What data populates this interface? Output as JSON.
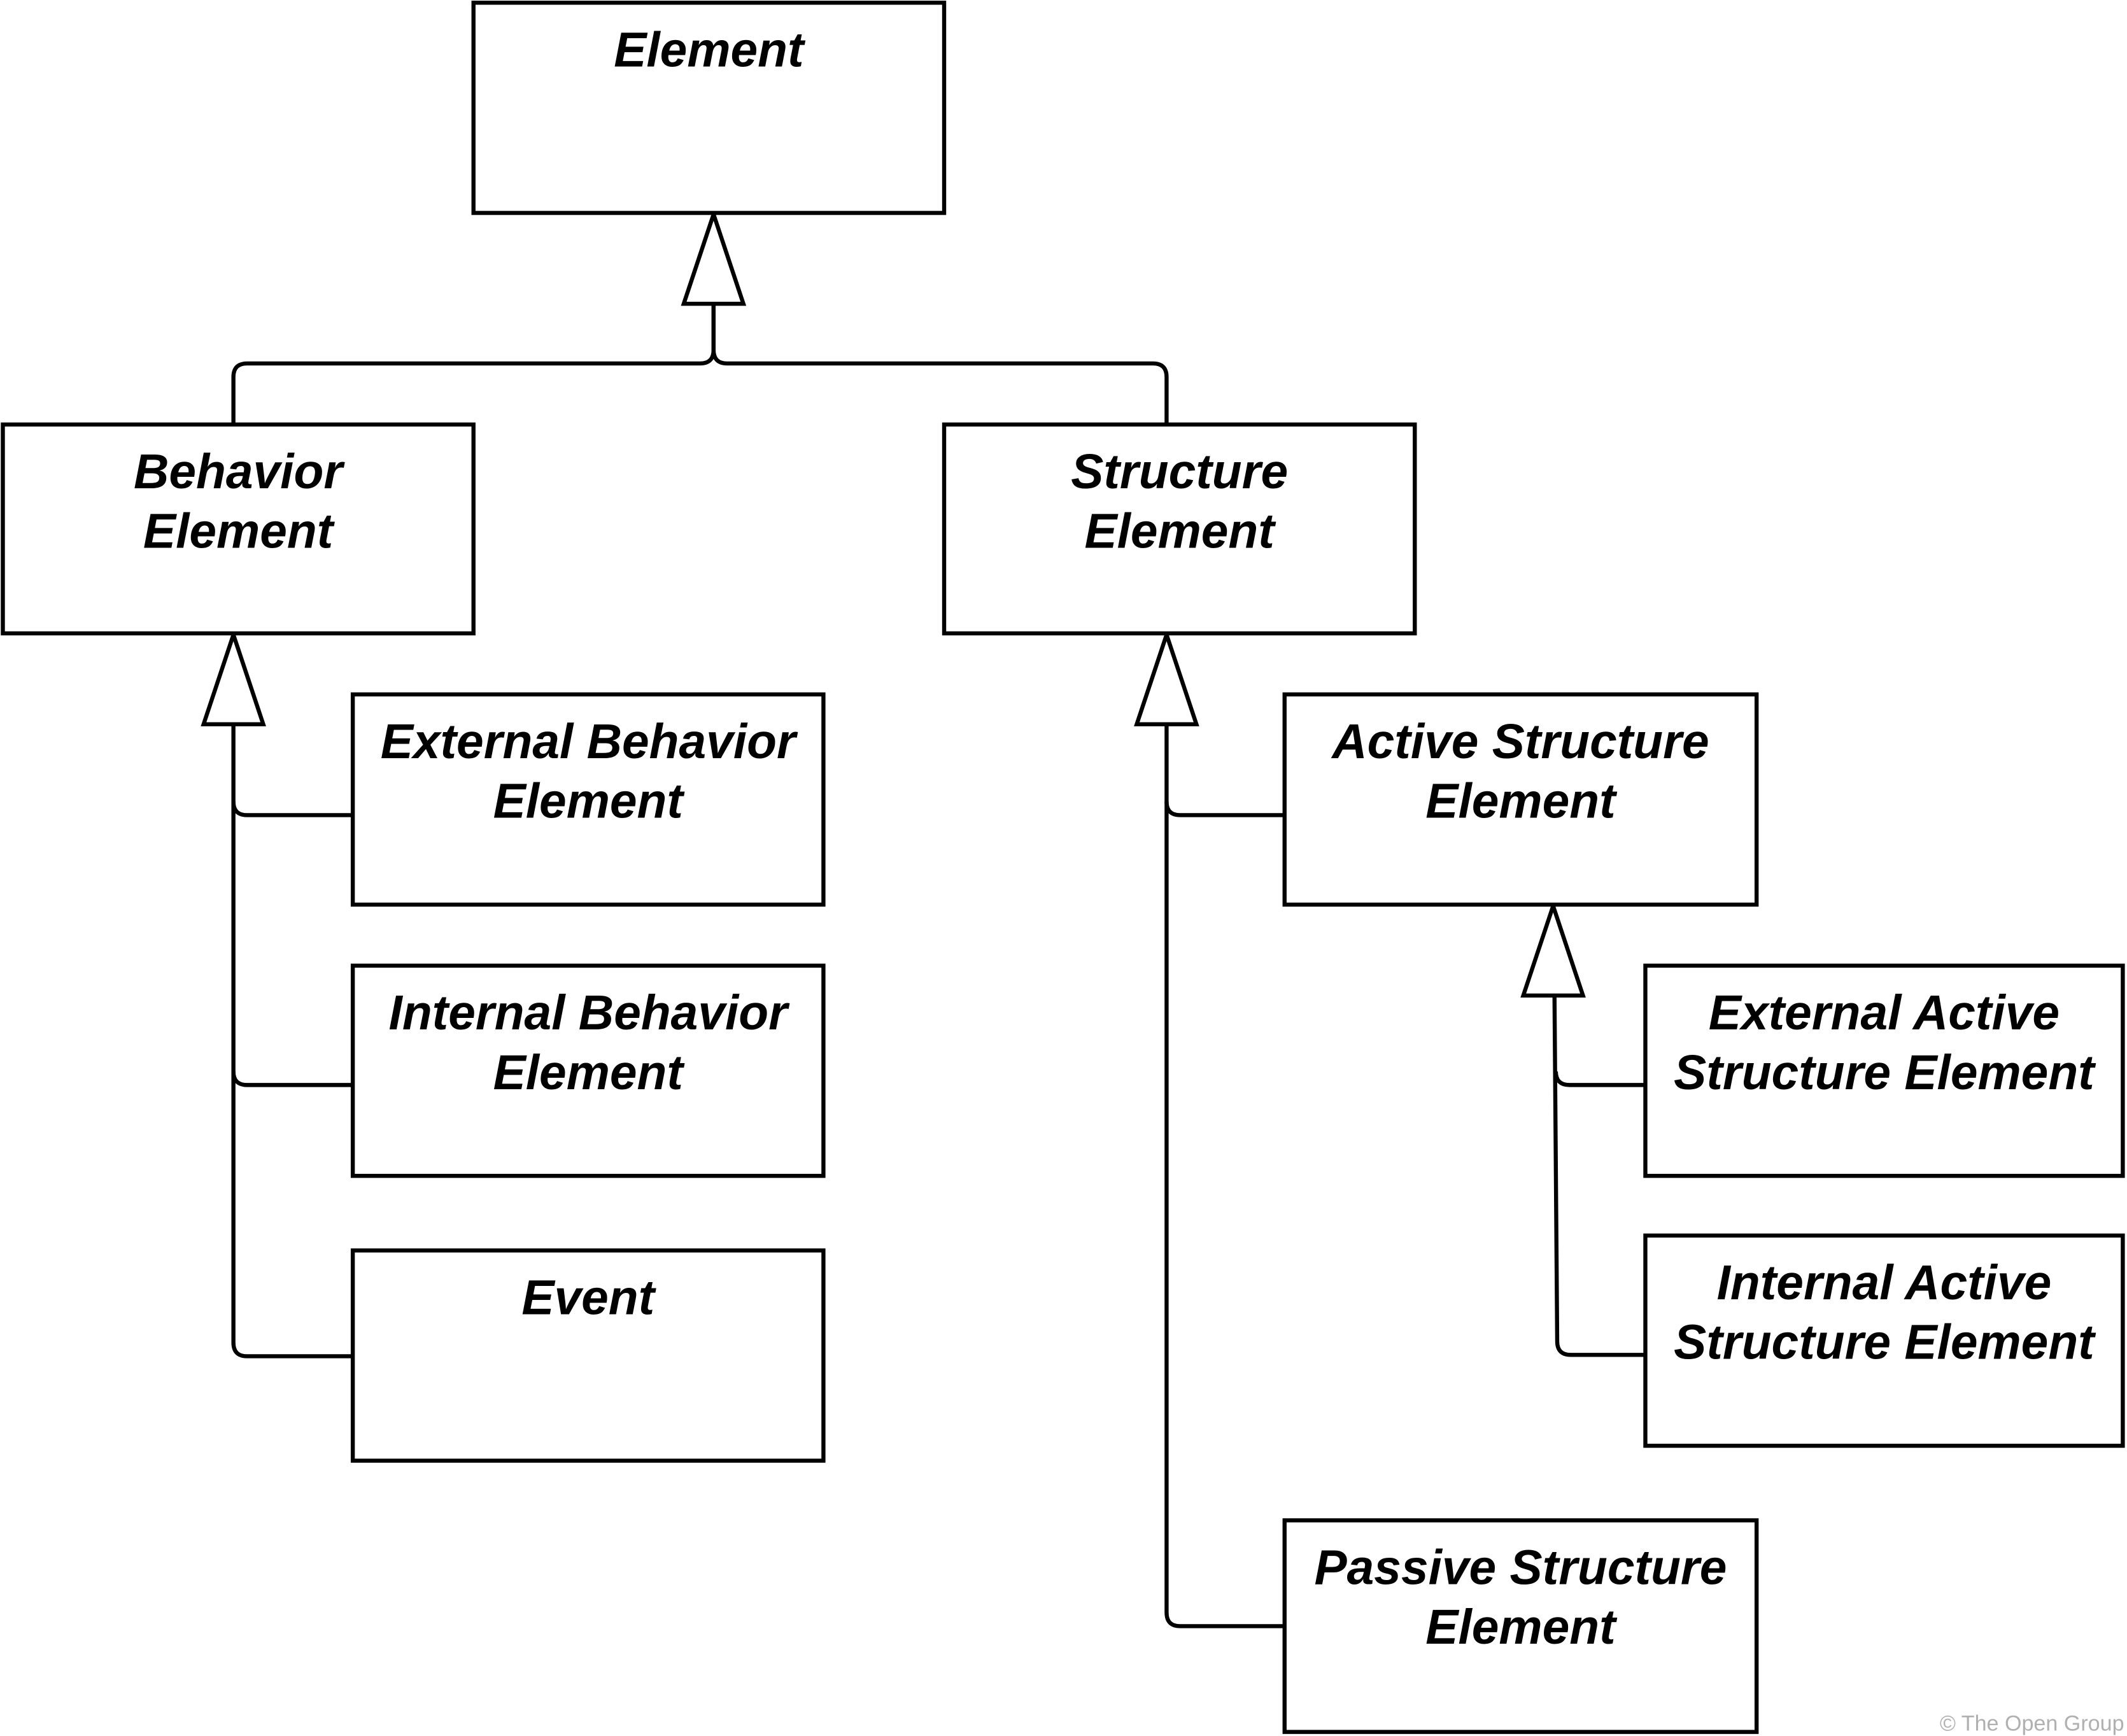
{
  "elements": [
    {
      "id": "element",
      "lines": [
        "Element"
      ]
    },
    {
      "id": "behavior-element",
      "lines": [
        "Behavior",
        "Element"
      ]
    },
    {
      "id": "structure-element",
      "lines": [
        "Structure",
        "Element"
      ]
    },
    {
      "id": "external-behavior-element",
      "lines": [
        "External Behavior",
        "Element"
      ]
    },
    {
      "id": "internal-behavior-element",
      "lines": [
        "Internal Behavior",
        "Element"
      ]
    },
    {
      "id": "event",
      "lines": [
        "Event"
      ]
    },
    {
      "id": "active-structure-element",
      "lines": [
        "Active Structure",
        "Element"
      ]
    },
    {
      "id": "external-active-structure-element",
      "lines": [
        "External Active",
        "Structure Element"
      ]
    },
    {
      "id": "internal-active-structure-element",
      "lines": [
        "Internal Active",
        "Structure Element"
      ]
    },
    {
      "id": "passive-structure-element",
      "lines": [
        "Passive Structure",
        "Element"
      ]
    }
  ],
  "relations": [
    {
      "type": "specialization",
      "from": "behavior-element",
      "to": "element"
    },
    {
      "type": "specialization",
      "from": "structure-element",
      "to": "element"
    },
    {
      "type": "specialization",
      "from": "external-behavior-element",
      "to": "behavior-element"
    },
    {
      "type": "specialization",
      "from": "internal-behavior-element",
      "to": "behavior-element"
    },
    {
      "type": "specialization",
      "from": "event",
      "to": "behavior-element"
    },
    {
      "type": "specialization",
      "from": "active-structure-element",
      "to": "structure-element"
    },
    {
      "type": "specialization",
      "from": "passive-structure-element",
      "to": "structure-element"
    },
    {
      "type": "specialization",
      "from": "external-active-structure-element",
      "to": "active-structure-element"
    },
    {
      "type": "specialization",
      "from": "internal-active-structure-element",
      "to": "active-structure-element"
    }
  ],
  "copyright": "© The Open Group"
}
